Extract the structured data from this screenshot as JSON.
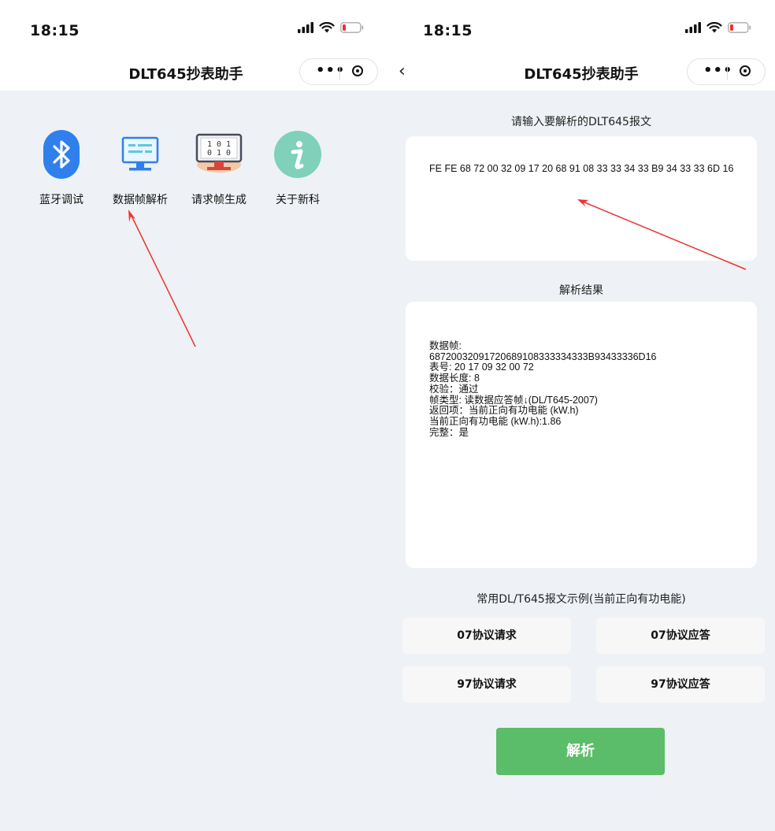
{
  "left_screen": {
    "status": {
      "time": "18:15"
    },
    "nav": {
      "title": "DLT645抄表助手"
    },
    "grid": [
      {
        "label": "蓝牙调试",
        "icon": "bluetooth-icon"
      },
      {
        "label": "数据帧解析",
        "icon": "monitor-icon"
      },
      {
        "label": "请求帧生成",
        "icon": "binary-monitor-icon"
      },
      {
        "label": "关于新科",
        "icon": "info-icon"
      }
    ]
  },
  "right_screen": {
    "status": {
      "time": "18:15"
    },
    "nav": {
      "title": "DLT645抄表助手",
      "back": "‹"
    },
    "input_title": "请输入要解析的DLT645报文",
    "input_value": "FE FE 68 72 00 32 09 17 20 68 91 08 33 33 34 33 B9 34 33 33 6D 16",
    "result_title": "解析结果",
    "result_lines": [
      "数据帧:",
      "68720032091720689108333334333B93433336D16",
      "表号: 20 17 09 32 00 72",
      "数据长度: 8",
      "校验：通过",
      "帧类型: 读数据应答帧↓(DL/T645-2007)",
      "返回项：当前正向有功电能 (kW.h)",
      "当前正向有功电能 (kW.h):1.86",
      "完整：是"
    ],
    "examples_title": "常用DL/T645报文示例(当前正向有功电能)",
    "examples": [
      "07协议请求",
      "07协议应答",
      "97协议请求",
      "97协议应答"
    ],
    "parse_button": "解析"
  },
  "colors": {
    "accent_green": "#5bbd69",
    "bluetooth_blue": "#2f80ed",
    "info_teal": "#7fd1b9",
    "arrow_red": "#ee3333"
  }
}
